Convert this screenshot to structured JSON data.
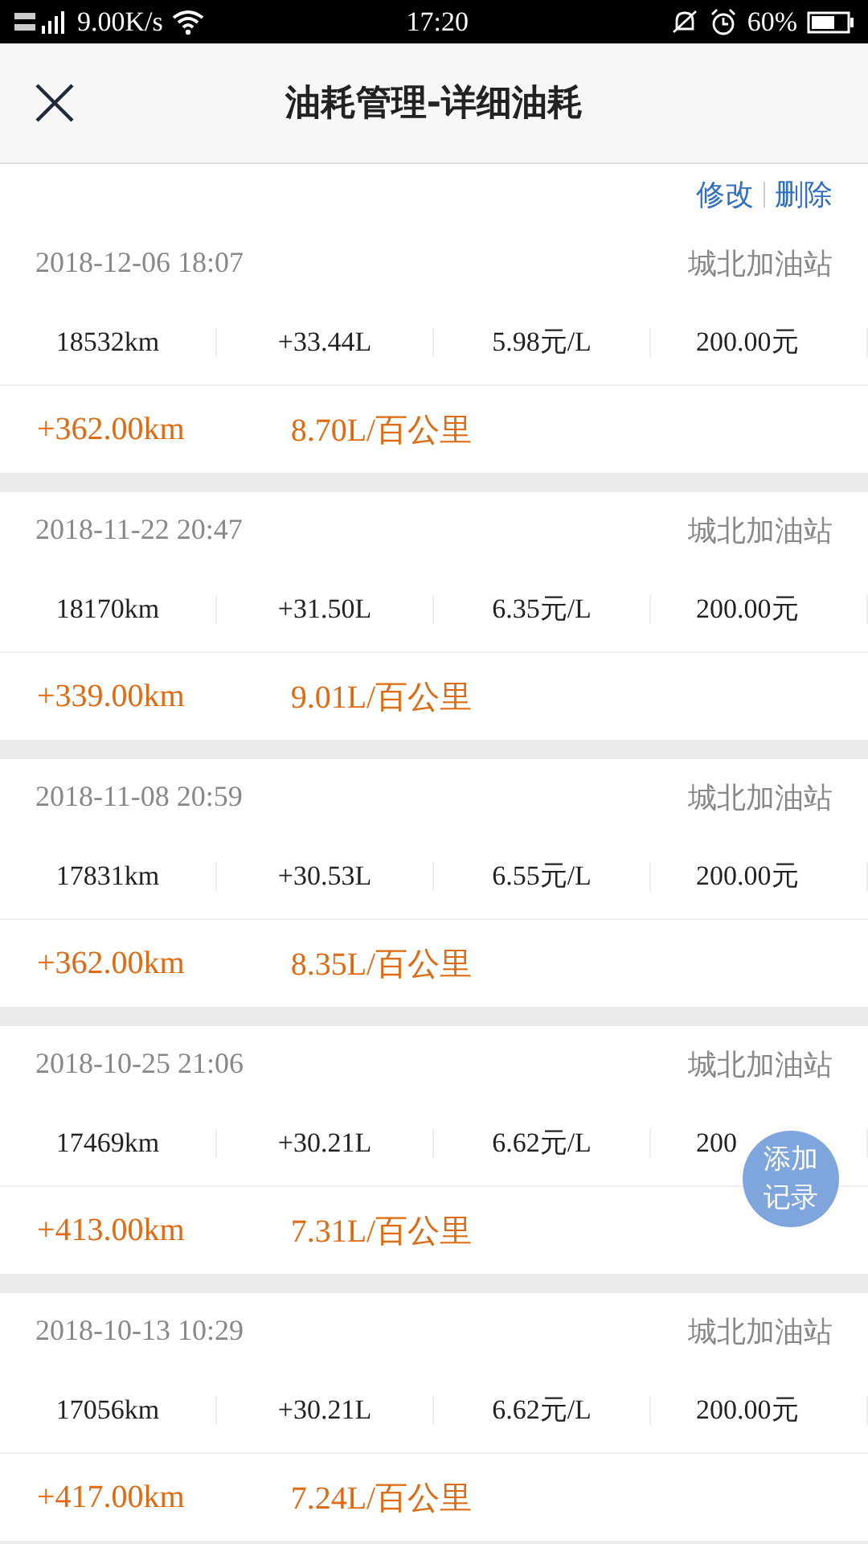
{
  "status_bar": {
    "network": "9.00K/s",
    "time": "17:20",
    "battery": "60%"
  },
  "header": {
    "title": "油耗管理-详细油耗"
  },
  "actions": [
    "修改",
    "删除"
  ],
  "records": [
    {
      "datetime": "2018-12-06 18:07",
      "station": "城北加油站",
      "odometer": "18532km",
      "volume": "+33.44L",
      "price": "5.98元/L",
      "amount": "200.00元",
      "distance": "+362.00km",
      "consumption": "8.70L/百公里"
    },
    {
      "datetime": "2018-11-22 20:47",
      "station": "城北加油站",
      "odometer": "18170km",
      "volume": "+31.50L",
      "price": "6.35元/L",
      "amount": "200.00元",
      "distance": "+339.00km",
      "consumption": "9.01L/百公里"
    },
    {
      "datetime": "2018-11-08 20:59",
      "station": "城北加油站",
      "odometer": "17831km",
      "volume": "+30.53L",
      "price": "6.55元/L",
      "amount": "200.00元",
      "distance": "+362.00km",
      "consumption": "8.35L/百公里"
    },
    {
      "datetime": "2018-10-25 21:06",
      "station": "城北加油站",
      "odometer": "17469km",
      "volume": "+30.21L",
      "price": "6.62元/L",
      "amount": "200",
      "distance": "+413.00km",
      "consumption": "7.31L/百公里"
    },
    {
      "datetime": "2018-10-13 10:29",
      "station": "城北加油站",
      "odometer": "17056km",
      "volume": "+30.21L",
      "price": "6.62元/L",
      "amount": "200.00元",
      "distance": "+417.00km",
      "consumption": "7.24L/百公里"
    }
  ],
  "fab": {
    "label": "添加记录"
  }
}
